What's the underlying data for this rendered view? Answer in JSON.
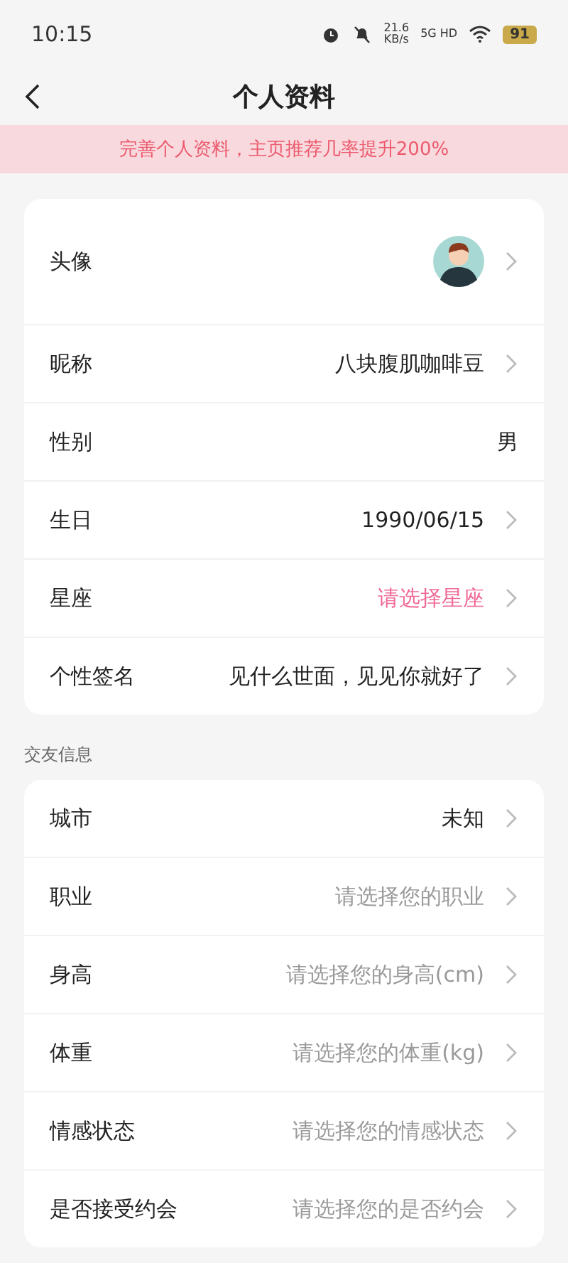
{
  "status_bar": {
    "time": "10:15",
    "speed": "21.6",
    "speed_unit": "KB/s",
    "network": "5G HD",
    "battery": "91"
  },
  "header": {
    "title": "个人资料"
  },
  "banner": {
    "text": "完善个人资料，主页推荐几率提升200%"
  },
  "profile": [
    {
      "kind": "avatar",
      "label": "头像",
      "chevron": true
    },
    {
      "kind": "value",
      "label": "昵称",
      "value": "八块腹肌咖啡豆",
      "chevron": true
    },
    {
      "kind": "value",
      "label": "性别",
      "value": "男",
      "chevron": false
    },
    {
      "kind": "value",
      "label": "生日",
      "value": "1990/06/15",
      "chevron": true
    },
    {
      "kind": "accent",
      "label": "星座",
      "value": "请选择星座",
      "chevron": true
    },
    {
      "kind": "value",
      "label": "个性签名",
      "value": "见什么世面，见见你就好了",
      "chevron": true
    }
  ],
  "dating_section": {
    "title": "交友信息"
  },
  "dating": [
    {
      "kind": "value",
      "label": "城市",
      "value": "未知",
      "chevron": true
    },
    {
      "kind": "placeholder",
      "label": "职业",
      "value": "请选择您的职业",
      "chevron": true
    },
    {
      "kind": "placeholder",
      "label": "身高",
      "value": "请选择您的身高(cm)",
      "chevron": true
    },
    {
      "kind": "placeholder",
      "label": "体重",
      "value": "请选择您的体重(kg)",
      "chevron": true
    },
    {
      "kind": "placeholder",
      "label": "情感状态",
      "value": "请选择您的情感状态",
      "chevron": true
    },
    {
      "kind": "placeholder",
      "label": "是否接受约会",
      "value": "请选择您的是否约会",
      "chevron": true
    }
  ]
}
